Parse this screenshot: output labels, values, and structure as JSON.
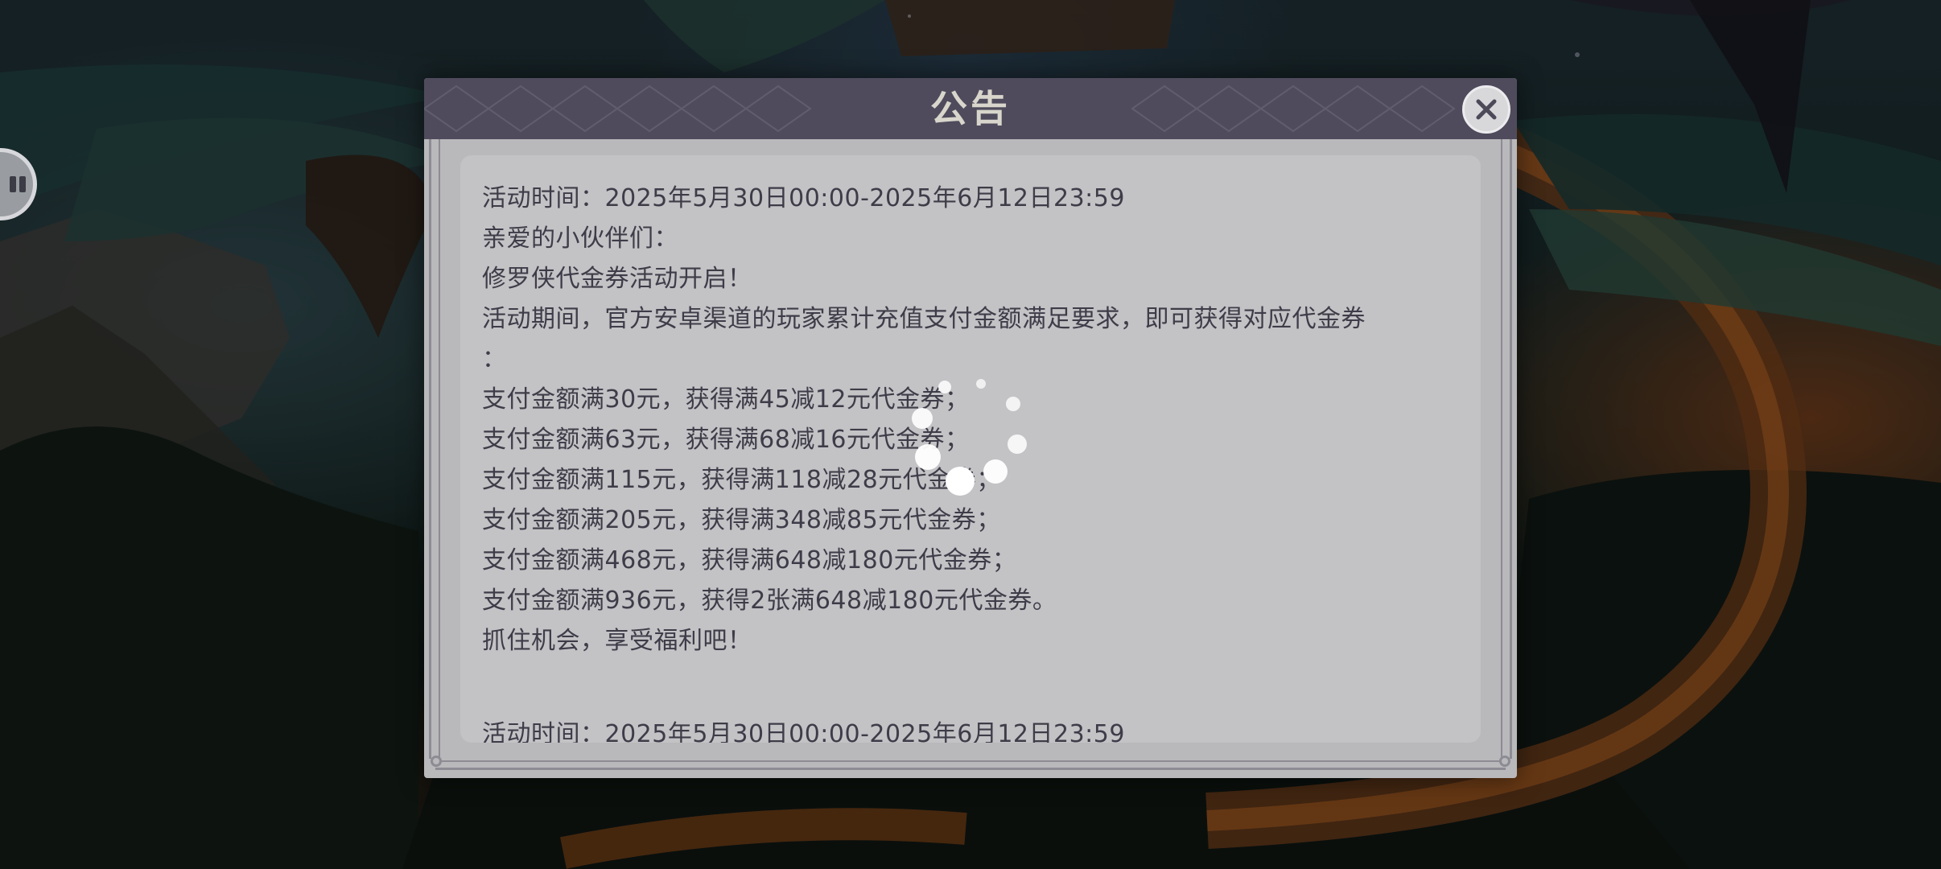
{
  "dialog": {
    "title": "公告",
    "close_icon": "close-icon",
    "lines": [
      "活动时间：2025年5月30日00:00-2025年6月12日23:59",
      "亲爱的小伙伴们：",
      "修罗侠代金券活动开启！",
      "活动期间，官方安卓渠道的玩家累计充值支付金额满足要求，即可获得对应代金券",
      "：",
      "支付金额满30元，获得满45减12元代金券；",
      "支付金额满63元，获得满68减16元代金券；",
      "支付金额满115元，获得满118减28元代金券；",
      "支付金额满205元，获得满348减85元代金券；",
      "支付金额满468元，获得满648减180元代金券；",
      "支付金额满936元，获得2张满648减180元代金券。",
      "抓住机会，享受福利吧！",
      "",
      "活动时间：2025年5月30日00:00-2025年6月12日23:59"
    ]
  },
  "side_button": {
    "icon": "pause-icon"
  },
  "spinner": {
    "icon": "loading-spinner-icon"
  }
}
